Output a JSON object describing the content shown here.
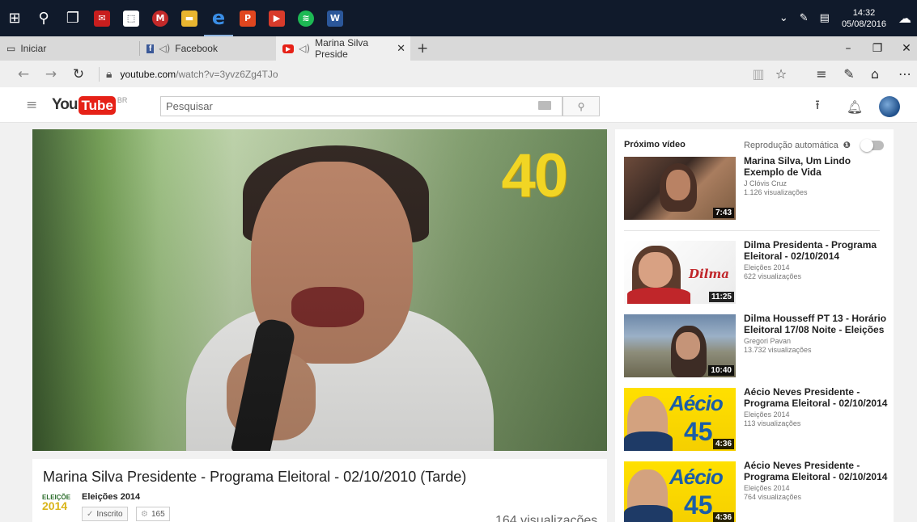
{
  "taskbar": {
    "clock_time": "14:32",
    "clock_date": "05/08/2016"
  },
  "tabs": [
    {
      "label": "Iniciar"
    },
    {
      "label": "Facebook"
    },
    {
      "label": "Marina Silva Preside"
    }
  ],
  "address": {
    "host": "youtube.com",
    "path": "/watch?v=3yvz6Zg4TJo"
  },
  "masthead": {
    "logo_you": "You",
    "logo_tube": "Tube",
    "logo_region": "BR",
    "search_placeholder": "Pesquisar"
  },
  "player": {
    "overlay_number": "40"
  },
  "video": {
    "title": "Marina Silva Presidente - Programa Eleitoral - 02/10/2010 (Tarde)",
    "channel_logo_text": "ELEIÇÕE",
    "channel_logo_year": "2014",
    "channel": "Eleições 2014",
    "subscribe_label": "Inscrito",
    "subscriber_count": "165",
    "views": "164 visualizações"
  },
  "sidebar": {
    "next_label": "Próximo vídeo",
    "autoplay_label": "Reprodução automática",
    "items": [
      {
        "title": "Marina Silva, Um Lindo Exemplo de Vida",
        "channel": "J Clóvis Cruz",
        "views": "1.126 visualizações",
        "duration": "7:43"
      },
      {
        "title": "Dilma Presidenta - Programa Eleitoral - 02/10/2014",
        "channel": "Eleições 2014",
        "views": "622 visualizações",
        "duration": "11:25",
        "thumb_text": "Dilma"
      },
      {
        "title": "Dilma Housseff PT 13 - Horário Eleitoral 17/08 Noite - Eleições",
        "channel": "Gregori Pavan",
        "views": "13.732 visualizações",
        "duration": "10:40"
      },
      {
        "title": "Aécio Neves Presidente - Programa Eleitoral - 02/10/2014",
        "channel": "Eleições 2014",
        "views": "113 visualizações",
        "duration": "4:36",
        "thumb_text": "Aécio",
        "thumb_num": "45"
      },
      {
        "title": "Aécio Neves Presidente - Programa Eleitoral - 02/10/2014",
        "channel": "Eleições 2014",
        "views": "764 visualizações",
        "duration": "4:36",
        "thumb_text": "Aécio",
        "thumb_num": "45"
      }
    ]
  },
  "colors": {
    "youtube_red": "#e62117",
    "taskbar_bg": "#101a2b",
    "overlay_yellow": "#f1d524"
  }
}
